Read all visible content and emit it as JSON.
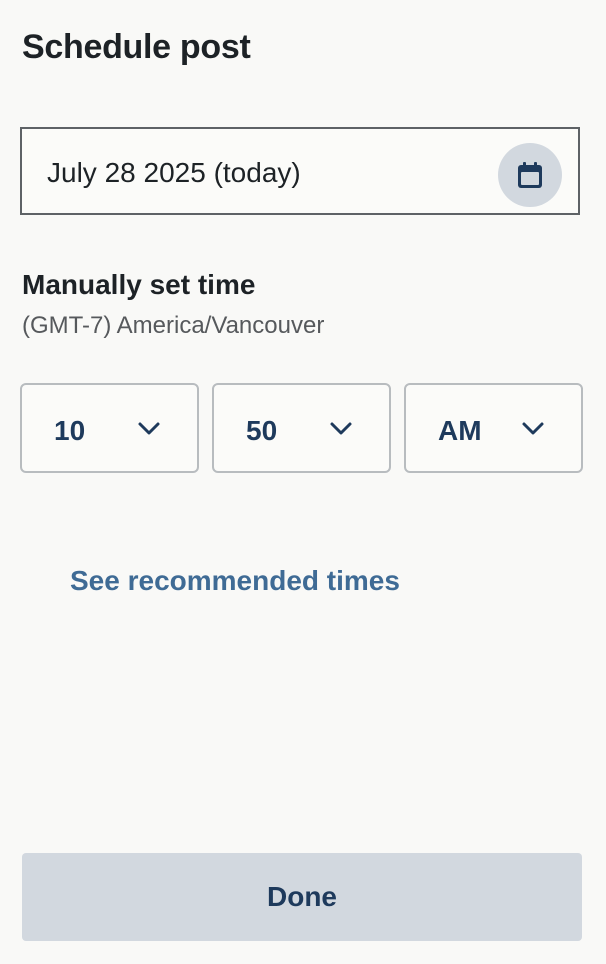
{
  "title": "Schedule post",
  "date": {
    "value": "July 28 2025 (today)",
    "icon": "calendar-icon"
  },
  "time": {
    "label": "Manually set time",
    "timezone": "(GMT-7) America/Vancouver",
    "hour": "10",
    "minute": "50",
    "period": "AM"
  },
  "recommended_link": "See recommended times",
  "done_label": "Done",
  "colors": {
    "accent": "#1e3a5c",
    "link": "#3f6b95",
    "button_bg": "#d2d8df",
    "background": "#f9f9f7"
  }
}
